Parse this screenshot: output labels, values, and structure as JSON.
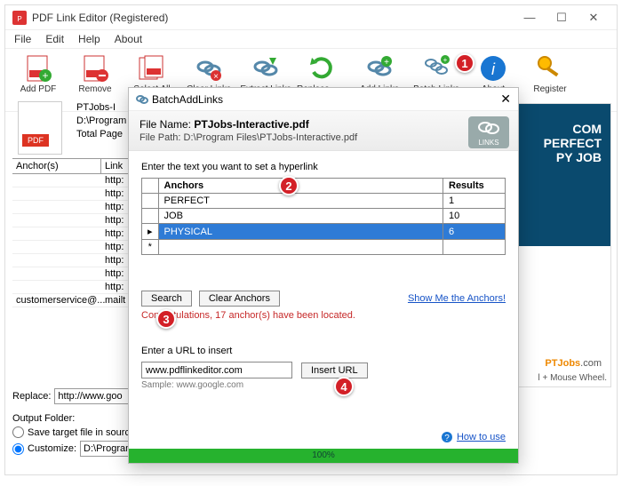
{
  "window": {
    "title": "PDF Link Editor (Registered)",
    "controls": {
      "min": "—",
      "max": "☐",
      "close": "✕"
    }
  },
  "menu": [
    "File",
    "Edit",
    "Help",
    "About"
  ],
  "toolbar": [
    {
      "label": "Add PDF",
      "icon": "add-pdf-icon"
    },
    {
      "label": "Remove",
      "icon": "remove-icon"
    },
    {
      "label": "Select All",
      "icon": "select-all-icon"
    },
    {
      "label": "Clear Links",
      "icon": "clear-links-icon"
    },
    {
      "label": "Extract Links",
      "icon": "extract-links-icon"
    },
    {
      "label": "Replace Links",
      "icon": "replace-links-icon"
    },
    {
      "label": "Add Links",
      "icon": "add-links-icon"
    },
    {
      "label": "Batch Links",
      "icon": "batch-links-icon"
    },
    {
      "label": "About",
      "icon": "about-icon"
    },
    {
      "label": "Register",
      "icon": "register-icon"
    }
  ],
  "fileinfo": {
    "name": "PTJobs-I",
    "path": "D:\\Program",
    "pages": "Total Page"
  },
  "grid": {
    "headers": [
      "Anchor(s)",
      "Link"
    ],
    "rows": [
      [
        "",
        "http:"
      ],
      [
        "",
        "http:"
      ],
      [
        "",
        "http:"
      ],
      [
        "",
        "http:"
      ],
      [
        "",
        "http:"
      ],
      [
        "",
        "http:"
      ],
      [
        "",
        "http:"
      ],
      [
        "",
        "http:"
      ],
      [
        "",
        "http:"
      ],
      [
        "customerservice@...",
        "mailt"
      ]
    ]
  },
  "bottom": {
    "replace_label": "Replace:",
    "replace_value": "http://www.goo",
    "output_label": "Output Folder:",
    "opt1": "Save target file in sourc",
    "opt2": "Customize:",
    "custom_path": "D:\\Program"
  },
  "preview": {
    "banner_line1": "COM",
    "banner_line2": "PERFECT",
    "banner_line3": "PY JOB",
    "brand": "PTJobs",
    "brand_suffix": ".com",
    "hint": "l + Mouse Wheel."
  },
  "modal": {
    "title": "BatchAddLinks",
    "file_name_label": "File Name:",
    "file_name": "PTJobs-Interactive.pdf",
    "file_path_label": "File Path:",
    "file_path": "D:\\Program Files\\PTJobs-Interactive.pdf",
    "links_badge": "LINKS",
    "prompt": "Enter the text you want to set a hyperlink",
    "table": {
      "headers": [
        "Anchors",
        "Results"
      ],
      "rows": [
        {
          "anchor": "PERFECT",
          "results": "1",
          "selected": false
        },
        {
          "anchor": "JOB",
          "results": "10",
          "selected": false
        },
        {
          "anchor": "PHYSICAL",
          "results": "6",
          "selected": true
        }
      ],
      "new_marker": "*"
    },
    "search_btn": "Search",
    "clear_btn": "Clear Anchors",
    "show_me": "Show Me the Anchors!",
    "status": "Congratulations, 17 anchor(s) have been located.",
    "url_label": "Enter a URL to insert",
    "url_value": "www.pdflinkeditor.com",
    "insert_btn": "Insert URL",
    "sample": "Sample: www.google.com",
    "how_to": "How to use",
    "progress": "100%"
  },
  "callouts": [
    "1",
    "2",
    "3",
    "4"
  ]
}
